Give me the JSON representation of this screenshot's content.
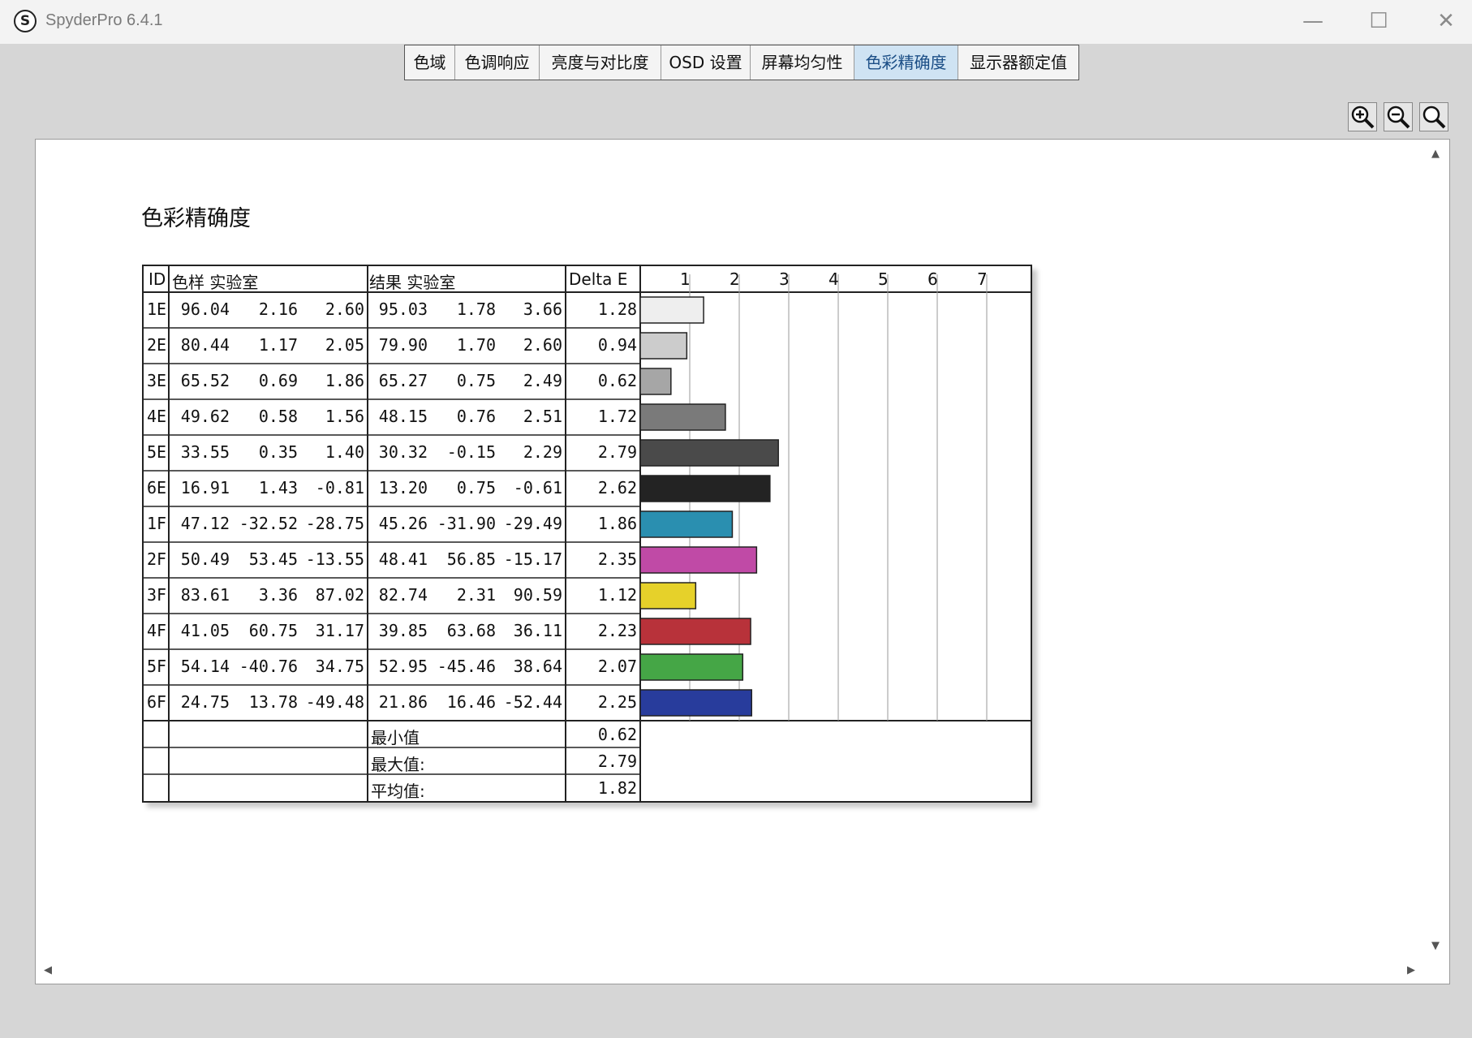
{
  "window": {
    "title": "SpyderPro 6.4.1",
    "logo_letter": "S",
    "minimize_glyph": "—",
    "maximize_glyph": "☐",
    "close_glyph": "✕"
  },
  "tabs": [
    {
      "label": "色域",
      "active": false
    },
    {
      "label": "色调响应",
      "active": false
    },
    {
      "label": "亮度与对比度",
      "active": false
    },
    {
      "label": "OSD 设置",
      "active": false
    },
    {
      "label": "屏幕均匀性",
      "active": false
    },
    {
      "label": "色彩精确度",
      "active": true
    },
    {
      "label": "显示器额定值",
      "active": false
    }
  ],
  "zoom_tools": [
    "zoom-in-icon",
    "zoom-out-icon",
    "zoom-fit-icon"
  ],
  "report": {
    "title": "色彩精确度",
    "headers": {
      "id": "ID",
      "sample": "色样 实验室",
      "result": "结果 实验室",
      "delta": "Delta E"
    },
    "chart_ticks": [
      "1",
      "2",
      "3",
      "4",
      "5",
      "6",
      "7"
    ],
    "rows": [
      {
        "id": "1E",
        "s": [
          "96.04",
          "2.16",
          "2.60"
        ],
        "r": [
          "95.03",
          "1.78",
          "3.66"
        ],
        "de": "1.28",
        "color": "#eeeeee"
      },
      {
        "id": "2E",
        "s": [
          "80.44",
          "1.17",
          "2.05"
        ],
        "r": [
          "79.90",
          "1.70",
          "2.60"
        ],
        "de": "0.94",
        "color": "#cccccc"
      },
      {
        "id": "3E",
        "s": [
          "65.52",
          "0.69",
          "1.86"
        ],
        "r": [
          "65.27",
          "0.75",
          "2.49"
        ],
        "de": "0.62",
        "color": "#a6a6a6"
      },
      {
        "id": "4E",
        "s": [
          "49.62",
          "0.58",
          "1.56"
        ],
        "r": [
          "48.15",
          "0.76",
          "2.51"
        ],
        "de": "1.72",
        "color": "#7a7a7a"
      },
      {
        "id": "5E",
        "s": [
          "33.55",
          "0.35",
          "1.40"
        ],
        "r": [
          "30.32",
          "-0.15",
          "2.29"
        ],
        "de": "2.79",
        "color": "#4a4a4a"
      },
      {
        "id": "6E",
        "s": [
          "16.91",
          "1.43",
          "-0.81"
        ],
        "r": [
          "13.20",
          "0.75",
          "-0.61"
        ],
        "de": "2.62",
        "color": "#232323"
      },
      {
        "id": "1F",
        "s": [
          "47.12",
          "-32.52",
          "-28.75"
        ],
        "r": [
          "45.26",
          "-31.90",
          "-29.49"
        ],
        "de": "1.86",
        "color": "#2a8fb0"
      },
      {
        "id": "2F",
        "s": [
          "50.49",
          "53.45",
          "-13.55"
        ],
        "r": [
          "48.41",
          "56.85",
          "-15.17"
        ],
        "de": "2.35",
        "color": "#c04aa6"
      },
      {
        "id": "3F",
        "s": [
          "83.61",
          "3.36",
          "87.02"
        ],
        "r": [
          "82.74",
          "2.31",
          "90.59"
        ],
        "de": "1.12",
        "color": "#e6d12a"
      },
      {
        "id": "4F",
        "s": [
          "41.05",
          "60.75",
          "31.17"
        ],
        "r": [
          "39.85",
          "63.68",
          "36.11"
        ],
        "de": "2.23",
        "color": "#b8323a"
      },
      {
        "id": "5F",
        "s": [
          "54.14",
          "-40.76",
          "34.75"
        ],
        "r": [
          "52.95",
          "-45.46",
          "38.64"
        ],
        "de": "2.07",
        "color": "#45a646"
      },
      {
        "id": "6F",
        "s": [
          "24.75",
          "13.78",
          "-49.48"
        ],
        "r": [
          "21.86",
          "16.46",
          "-52.44"
        ],
        "de": "2.25",
        "color": "#283c9c"
      }
    ],
    "summary": [
      {
        "label": "最小值",
        "value": "0.62"
      },
      {
        "label": "最大值:",
        "value": "2.79"
      },
      {
        "label": "平均值:",
        "value": "1.82"
      }
    ]
  },
  "chart_data": {
    "type": "bar",
    "orientation": "horizontal",
    "categories": [
      "1E",
      "2E",
      "3E",
      "4E",
      "5E",
      "6E",
      "1F",
      "2F",
      "3F",
      "4F",
      "5F",
      "6F"
    ],
    "values": [
      1.28,
      0.94,
      0.62,
      1.72,
      2.79,
      2.62,
      1.86,
      2.35,
      1.12,
      2.23,
      2.07,
      2.25
    ],
    "xlabel": "Delta E",
    "xlim": [
      0,
      8
    ],
    "grid": true
  }
}
